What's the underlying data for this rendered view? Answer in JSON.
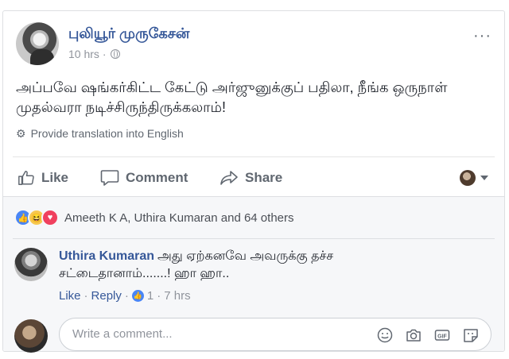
{
  "post": {
    "author": "புலியூர் முருகேசன்",
    "time": "10 hrs",
    "meta_sep": "·",
    "text": "அப்பவே ஷங்கர்கிட்ட கேட்டு அர்ஜுனுக்குப் பதிலா, நீங்க ஒருநாள் முதல்வரா நடிச்சிருந்திருக்கலாம்!",
    "translate_link": "Provide translation into English",
    "more_label": "···"
  },
  "actions": {
    "like": "Like",
    "comment": "Comment",
    "share": "Share"
  },
  "reactions": {
    "icons": [
      "like-icon",
      "haha-icon",
      "love-icon"
    ],
    "summary": "Ameeth K A, Uthira Kumaran and 64 others"
  },
  "comment": {
    "author": "Uthira Kumaran",
    "text": "அது ஏற்கனவே அவருக்கு தச்ச சட்டைதானாம்.......! ஹா ஹா..",
    "like": "Like",
    "reply": "Reply",
    "like_count": "1",
    "time": "7 hrs",
    "sep": "·"
  },
  "composer": {
    "placeholder": "Write a comment..."
  },
  "colors": {
    "link": "#365899",
    "muted": "#90949c",
    "action": "#606770",
    "like": "#4a86f5",
    "love": "#f0405e"
  }
}
